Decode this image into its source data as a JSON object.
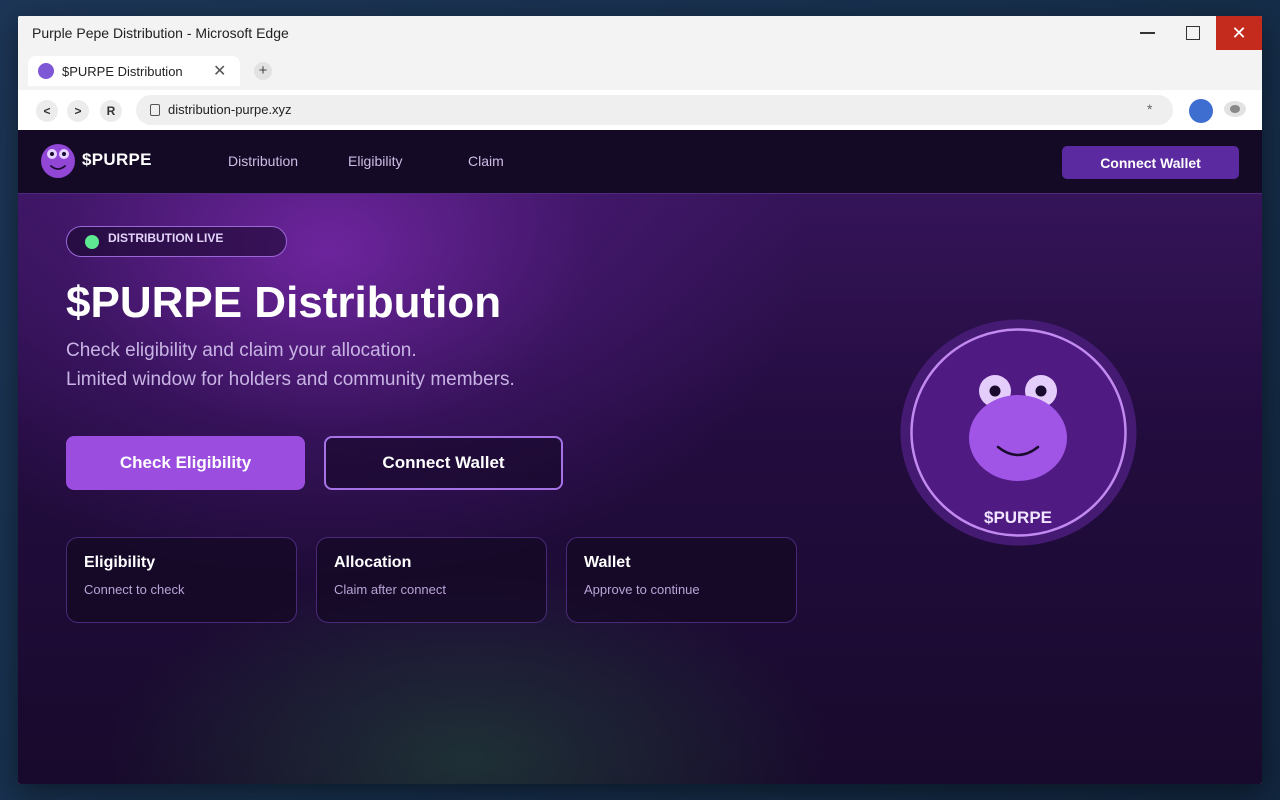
{
  "window": {
    "title": "Purple Pepe Distribution - Microsoft Edge",
    "close_glyph": "✕"
  },
  "browser": {
    "tab_title": "$PURPE Distribution",
    "tab_close_glyph": "✕",
    "new_tab_glyph": "+",
    "nav_back": "<",
    "nav_forward": ">",
    "nav_reload": "R",
    "url": "distribution-purpe.xyz",
    "favorite_glyph": "*"
  },
  "header": {
    "logo_text": "$PURPE",
    "nav": [
      "Distribution",
      "Eligibility",
      "Claim"
    ],
    "connect_label": "Connect Wallet"
  },
  "hero": {
    "badge": "DISTRIBUTION LIVE",
    "title": "$PURPE Distribution",
    "subtitle_line1": "Check eligibility and claim your allocation.",
    "subtitle_line2": "Limited window for holders and community members.",
    "primary_button": "Check Eligibility",
    "secondary_button": "Connect Wallet"
  },
  "cards": [
    {
      "title": "Eligibility",
      "subtitle": "Connect to check"
    },
    {
      "title": "Allocation",
      "subtitle": "Claim after connect"
    },
    {
      "title": "Wallet",
      "subtitle": "Approve to continue"
    }
  ],
  "coin": {
    "label": "$PURPE"
  },
  "colors": {
    "accent": "#9a4ddf",
    "header_button": "#5c2aa0",
    "live_dot": "#5ee892",
    "close_button": "#c42b1c"
  },
  "icons": {
    "logo": "pepe-frog-icon",
    "coin": "pepe-frog-coin-icon",
    "live": "status-dot-icon",
    "lock": "lock-icon"
  }
}
